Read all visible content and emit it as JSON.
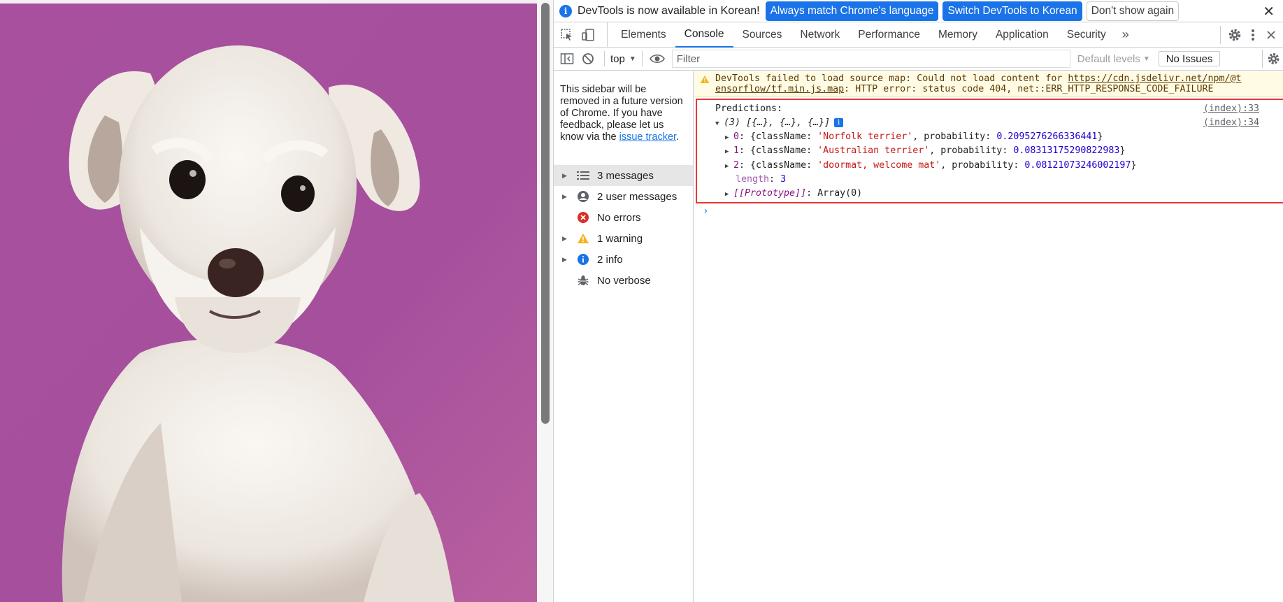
{
  "infobar": {
    "message": "DevTools is now available in Korean!",
    "btn_match": "Always match Chrome's language",
    "btn_switch": "Switch DevTools to Korean",
    "btn_dismiss": "Don't show again",
    "close_glyph": "✕"
  },
  "tabs": [
    "Elements",
    "Console",
    "Sources",
    "Network",
    "Performance",
    "Memory",
    "Application",
    "Security"
  ],
  "active_tab": "Console",
  "toolbar": {
    "context": "top",
    "filter_placeholder": "Filter",
    "levels": "Default levels",
    "issues": "No Issues"
  },
  "sidebar": {
    "notice_before": "This sidebar will be removed in a future version of Chrome. If you have feedback, please let us know via the ",
    "notice_link": "issue tracker",
    "notice_after": ".",
    "items": [
      {
        "label": "3 messages",
        "icon": "list-icon"
      },
      {
        "label": "2 user messages",
        "icon": "user-icon"
      },
      {
        "label": "No errors",
        "icon": "error-icon"
      },
      {
        "label": "1 warning",
        "icon": "warning-icon"
      },
      {
        "label": "2 info",
        "icon": "info-icon"
      },
      {
        "label": "No verbose",
        "icon": "bug-icon"
      }
    ]
  },
  "console": {
    "warning_prefix": "DevTools failed to load source map: Could not load content for ",
    "warning_url_1": "https://cdn.jsdelivr.net/npm/@t",
    "warning_url_2": "ensorflow/tf.min.js.map",
    "warning_suffix": ": HTTP error: status code 404, net::ERR_HTTP_RESPONSE_CODE_FAILURE",
    "log_label": "Predictions:",
    "log_source_1": "(index):33",
    "log_source_2": "(index):34",
    "array_summary": "(3) [{…}, {…}, {…}]",
    "predictions": [
      {
        "index": "0",
        "className": "'Norfolk terrier'",
        "probability": "0.2095276266336441"
      },
      {
        "index": "1",
        "className": "'Australian terrier'",
        "probability": "0.08313175290822983"
      },
      {
        "index": "2",
        "className": "'doormat, welcome mat'",
        "probability": "0.08121073246002197"
      }
    ],
    "length_key": "length",
    "length_value": "3",
    "prototype_key": "[[Prototype]]",
    "prototype_value": "Array(0)",
    "key_className": "className",
    "key_probability": "probability"
  },
  "colors": {
    "accent": "#1a73e8",
    "highlight_border": "#e53935",
    "warning_bg": "#fffbe5",
    "photo_backdrop": "#a54f9d"
  }
}
